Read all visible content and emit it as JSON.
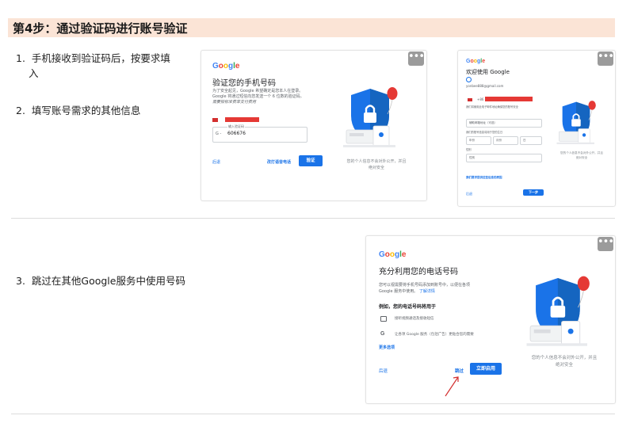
{
  "heading": "第4步：通过验证码进行账号验证",
  "steps": [
    {
      "num": "1.",
      "text_line1": "手机接收到验证码后，按要求填",
      "text_line2": "入"
    },
    {
      "num": "2.",
      "text": "填写账号需求的其他信息"
    },
    {
      "num": "3.",
      "text": "跳过在其他Google服务中使用号码"
    }
  ],
  "more_glyph": "•••",
  "google_logo": {
    "G": "G",
    "o1": "o",
    "o2": "o",
    "g": "g",
    "l": "l",
    "e": "e"
  },
  "card1": {
    "title": "验证您的手机号码",
    "desc1": "为了安全起见，Google 希望确定是您本人在登录。",
    "desc2": "Google 将通过短信向您发送一个 6 位数的验证码。",
    "desc3": "需要按标准费率支付费用",
    "code_label": "输入验证码",
    "code_prefix": "G -",
    "code_value": "606676",
    "back": "后退",
    "call_instead": "改打语音电话",
    "verify": "验证",
    "privacy1": "您的个人信息不会对外公开，并且",
    "privacy2": "绝对安全"
  },
  "card2": {
    "title": "欢迎使用 Google",
    "email": "yonbee888@gmail.com",
    "phone_prefix": "+86",
    "recovery_placeholder": "辅助邮箱地址（可选）",
    "help1": "我们将使用此电子邮件地址确保您的账号安全",
    "help2": "我们的账号信息将用于您的生日",
    "year": "年份",
    "month": "月份",
    "day": "日",
    "gender": "性别",
    "gender_value": "性别",
    "why": "我们要求提供这些信息的原因",
    "back": "后退",
    "next": "下一步",
    "privacy1": "您的个人信息不会对外公开，并且",
    "privacy2": "绝对安全"
  },
  "card3": {
    "title": "充分利用您的电话号码",
    "desc1": "您可以视需要将手机号码添加到账号中，以便在各项",
    "desc2": "Google 服务中使用。",
    "learn_more": "了解详情",
    "example": "例如，您的电话号码将用于",
    "item1": "接听视频通话及接收短信",
    "item2": "让各项 Google 服务（包括广告）更贴合您的需要",
    "more_options": "更多选项",
    "back": "后退",
    "skip": "跳过",
    "enable": "立即启用",
    "privacy1": "您的个人信息不会对外公开，并且",
    "privacy2": "绝对安全"
  },
  "colors": {
    "heading_bg": "#fbe4d6",
    "accent": "#1a73e8",
    "shield": "#1a73e8",
    "balloon": "#e53935"
  }
}
